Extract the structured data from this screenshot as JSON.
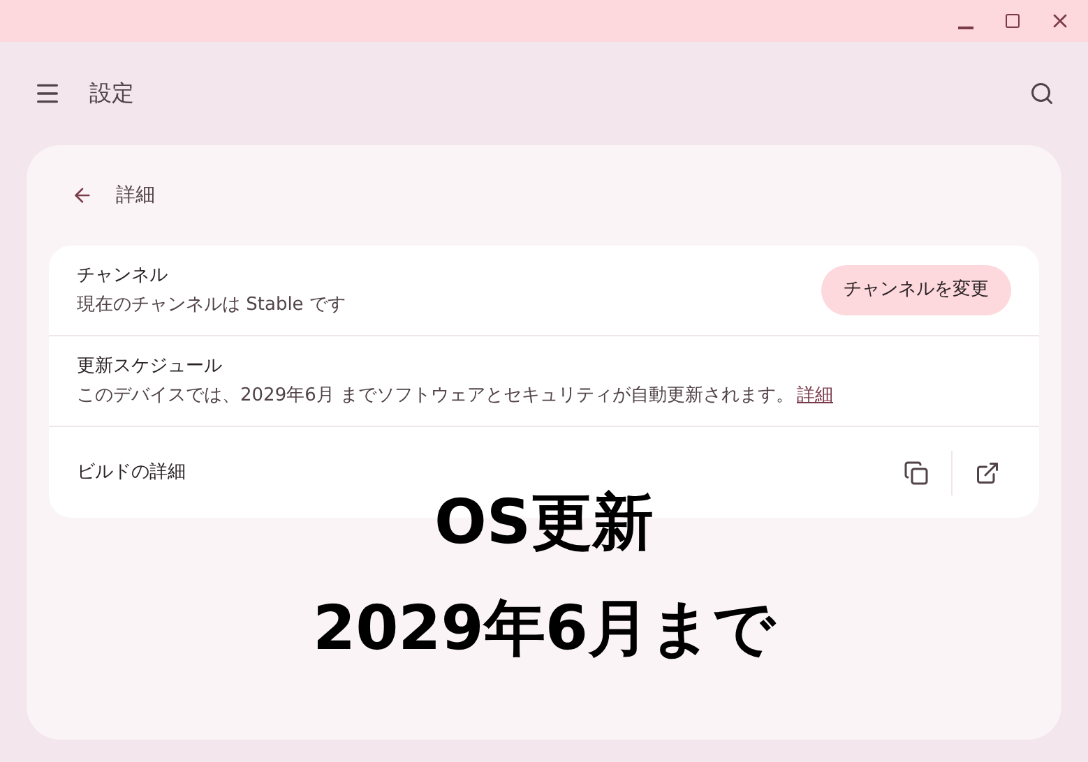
{
  "window": {
    "controls": [
      {
        "kind": "minimize"
      },
      {
        "kind": "maximize"
      },
      {
        "kind": "close"
      }
    ]
  },
  "header": {
    "title": "設定"
  },
  "page": {
    "title": "詳細"
  },
  "rows": [
    {
      "kind": "button",
      "title": "チャンネル",
      "subtitle": "現在のチャンネルは Stable です",
      "button": "チャンネルを変更"
    },
    {
      "kind": "link",
      "title": "更新スケジュール",
      "subtitle": "このデバイスでは、2029年6月 までソフトウェアとセキュリティが自動更新されます。",
      "link": "詳細"
    },
    {
      "kind": "actions",
      "title": "ビルドの詳細"
    }
  ],
  "caption": [
    "OS更新",
    "2029年6月まで"
  ]
}
